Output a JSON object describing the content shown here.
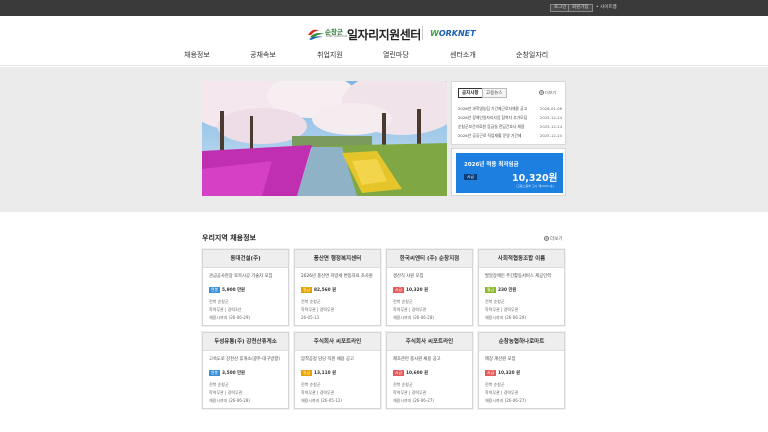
{
  "topbar": {
    "login": "로그인",
    "join": "회원가입",
    "sitemap": "• 사이트맵"
  },
  "header": {
    "logo_sub": "순창군",
    "logo_subsub": "SUNCHANG-GUN",
    "title": "일자리지원센터",
    "worknet_w": "W",
    "worknet_rest": "ORKNET"
  },
  "nav": [
    "채용정보",
    "공채속보",
    "취업지원",
    "열린마당",
    "센터소개",
    "순창일자리"
  ],
  "notice": {
    "tabs": [
      "공지사항",
      "고용뉴스"
    ],
    "more": "더보기",
    "items": [
      {
        "title": "2026년 과학영농팀 기간제근로자채용 공고",
        "date": "2026-01-06"
      },
      {
        "title": "2026년 장애인일자리사업 참여자 추가모집",
        "date": "2025-12-24"
      },
      {
        "title": "순창군보건의료원 응급실 전담간호사 채용",
        "date": "2025-12-24"
      },
      {
        "title": "2026년 공공근로 직업재활 운영 기간제",
        "date": "2025-12-24"
      }
    ]
  },
  "wage": {
    "title": "2026년 적용 최저임금",
    "badge": "시급",
    "amount": "10,320원",
    "note": "(고용노동부 고시 제2025-호)"
  },
  "section": {
    "title": "우리지역 채용정보",
    "more": "더보기"
  },
  "jobs": [
    {
      "company": "동대건설(주)",
      "title": "관급공사현장 토목시공 기술자 모집",
      "wage_type": "연봉",
      "wage_color": "#3a8fd9",
      "wage": "5,900 만원",
      "location": "전북 순창군",
      "career": "학력무관 | 경력3년",
      "deadline": "채용시까지 (26-06-29)"
    },
    {
      "company": "풍산면 행정복지센터",
      "title": "2026년 풍산면 지방세 변동자료 조사원",
      "wage_type": "일급",
      "wage_color": "#e5a200",
      "wage": "82,560 원",
      "location": "전북 순창군",
      "career": "학력무관 | 경력무관",
      "deadline": "26-05-13"
    },
    {
      "company": "한국씨엔티 (주) 순창지점",
      "title": "생산직 사원 모집",
      "wage_type": "시급",
      "wage_color": "#e35d5d",
      "wage": "10,320 원",
      "location": "전북 순창군",
      "career": "학력무관 | 경력무관",
      "deadline": "채용시까지 (26-06-28)"
    },
    {
      "company": "사회적협동조합 이룸",
      "title": "발달장애인 주간활동서비스 제공인력",
      "wage_type": "월급",
      "wage_color": "#8bb830",
      "wage": "230 만원",
      "location": "전북 순창군",
      "career": "학력무관 | 경력무관",
      "deadline": "채용시까지 (26-06-29)"
    },
    {
      "company": "두성유통(주) 강천산휴게소",
      "title": "고속도로 강천산 휴게소(광주-대구방향)",
      "wage_type": "연봉",
      "wage_color": "#3a8fd9",
      "wage": "3,500 만원",
      "location": "전북 순창군",
      "career": "학력무관 | 경력무관",
      "deadline": "채용시까지 (26-06-28)"
    },
    {
      "company": "주식회사 씨포트라인",
      "title": "압착공정 담당 직원 채용 공고",
      "wage_type": "일급",
      "wage_color": "#e5a200",
      "wage": "13,110 원",
      "location": "전북 순창군",
      "career": "학력무관 | 경력무관",
      "deadline": "채용시까지 (26-05-12)"
    },
    {
      "company": "주식회사 씨포트라인",
      "title": "제조관련 종사원 채용 공고",
      "wage_type": "시급",
      "wage_color": "#e35d5d",
      "wage": "10,600 원",
      "location": "전북 순창군",
      "career": "학력무관 | 경력무관",
      "deadline": "채용시까지 (26-06-27)"
    },
    {
      "company": "순창농협하나로마트",
      "title": "매장 계산원 모집",
      "wage_type": "시급",
      "wage_color": "#e35d5d",
      "wage": "10,320 원",
      "location": "전북 순창군",
      "career": "학력무관 | 경력무관",
      "deadline": "채용시까지 (26-06-27)"
    }
  ]
}
